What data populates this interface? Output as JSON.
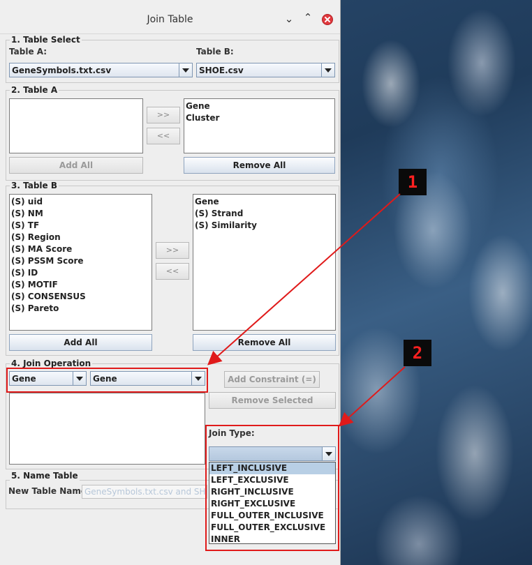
{
  "window": {
    "title": "Join Table"
  },
  "section1": {
    "title": "1. Table Select",
    "table_a_label": "Table A:",
    "table_a_value": "GeneSymbols.txt.csv",
    "table_b_label": "Table B:",
    "table_b_value": "SHOE.csv"
  },
  "section2": {
    "title": "2. Table A",
    "left_list": [],
    "right_list": [
      "Gene",
      "Cluster"
    ],
    "move_right": ">>",
    "move_left": "<<",
    "add_all": "Add All",
    "remove_all": "Remove All"
  },
  "section3": {
    "title": "3. Table B",
    "left_list": [
      "(S) uid",
      "(S) NM",
      "(S) TF",
      "(S) Region",
      "(S) MA Score",
      "(S) PSSM Score",
      "(S) ID",
      "(S) MOTIF",
      "(S) CONSENSUS",
      "(S) Pareto"
    ],
    "right_list": [
      "Gene",
      "(S) Strand",
      "(S) Similarity"
    ],
    "move_right": ">>",
    "move_left": "<<",
    "add_all": "Add All",
    "remove_all": "Remove All"
  },
  "section4": {
    "title": "4. Join Operation",
    "left_column": "Gene",
    "right_column": "Gene",
    "add_constraint": "Add Constraint (=)",
    "remove_selected": "Remove Selected",
    "join_type_label": "Join Type:",
    "join_type_value": "",
    "join_type_options": [
      "LEFT_INCLUSIVE",
      "LEFT_EXCLUSIVE",
      "RIGHT_INCLUSIVE",
      "RIGHT_EXCLUSIVE",
      "FULL_OUTER_INCLUSIVE",
      "FULL_OUTER_EXCLUSIVE",
      "INNER"
    ],
    "highlighted_option": "LEFT_INCLUSIVE"
  },
  "section5": {
    "title": "5. Name Table",
    "new_table_label": "New Table Name:",
    "new_table_value": "GeneSymbols.txt.csv and SHOE.csv"
  },
  "annotations": {
    "callout_1": "1",
    "callout_2": "2",
    "color": "#e01a1a"
  }
}
